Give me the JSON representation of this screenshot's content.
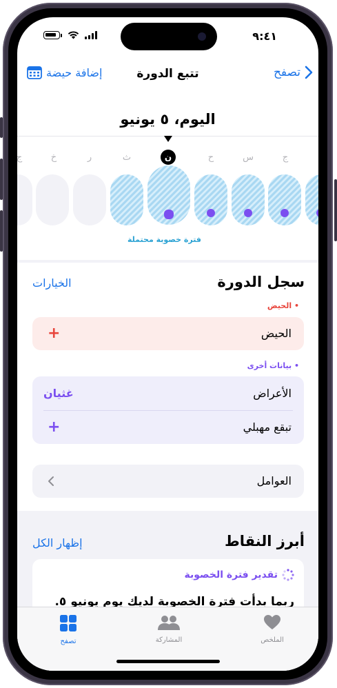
{
  "status": {
    "time": "٩:٤١"
  },
  "nav": {
    "title": "تتبع الدورة",
    "back_label": "تصفح",
    "add_label": "إضافة حيضة"
  },
  "day_title": "اليوم، ٥ يونيو",
  "calendar": {
    "letters": [
      "ج",
      "س",
      "ح",
      "ن",
      "ث",
      "ر",
      "خ",
      "ج"
    ],
    "fertile_label": "فترة خصوبة محتملة"
  },
  "cycle_log": {
    "title": "سجل الدورة",
    "options_label": "الخيارات",
    "period_category": "• الحيض",
    "period_row": "الحيض",
    "other_category": "• بيانات أخرى",
    "symptoms_row": "الأعراض",
    "symptoms_value": "غثيان",
    "spotting_row": "تبقع مهبلي",
    "factors_row": "العوامل"
  },
  "highlights": {
    "title": "أبرز النقاط",
    "show_all": "إظهار الكل",
    "card_title": "تقدير فترة الخصوبة",
    "card_body": "ربما بدأت فترة الخصوبة لديك يوم يونيو ٥."
  },
  "tabs": [
    {
      "label": "الملخص",
      "icon": "heart-icon"
    },
    {
      "label": "المشاركة",
      "icon": "people-icon"
    },
    {
      "label": "تصفح",
      "icon": "grid-icon"
    }
  ],
  "colors": {
    "accent": "#1a73e8",
    "fertile": "#a9d8f2",
    "cycle_dot": "#7b4ff0",
    "period": "#e8453c",
    "other": "#7b4ff0"
  }
}
